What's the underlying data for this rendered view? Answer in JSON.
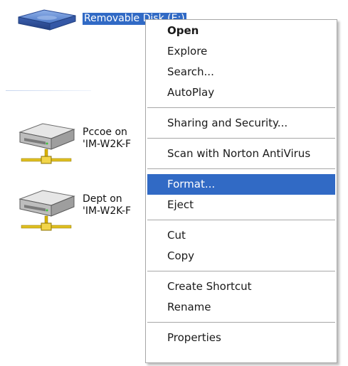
{
  "drives": {
    "removable": {
      "label": "Removable Disk (E:)",
      "selected": true
    },
    "pccoe": {
      "line1": "Pccoe on",
      "line2": "'IM-W2K-F"
    },
    "dept": {
      "line1": "Dept on",
      "line2": "'IM-W2K-F"
    }
  },
  "context_menu": {
    "groups": [
      [
        {
          "label": "Open",
          "bold": true
        },
        {
          "label": "Explore"
        },
        {
          "label": "Search..."
        },
        {
          "label": "AutoPlay"
        }
      ],
      [
        {
          "label": "Sharing and Security..."
        }
      ],
      [
        {
          "label": "Scan with Norton AntiVirus"
        }
      ],
      [
        {
          "label": "Format...",
          "highlighted": true
        },
        {
          "label": "Eject"
        }
      ],
      [
        {
          "label": "Cut"
        },
        {
          "label": "Copy"
        }
      ],
      [
        {
          "label": "Create Shortcut"
        },
        {
          "label": "Rename"
        }
      ],
      [
        {
          "label": "Properties"
        }
      ]
    ]
  },
  "colors": {
    "selection": "#316ac5",
    "menu_border": "#a7a7a7"
  }
}
